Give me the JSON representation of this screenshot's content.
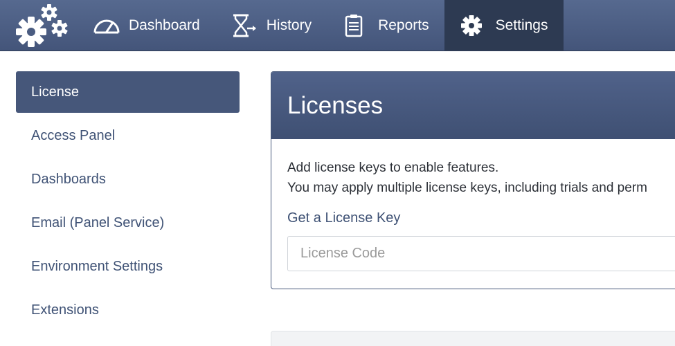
{
  "nav": {
    "logo_icon": "gears-icon",
    "items": [
      {
        "label": "Dashboard",
        "icon": "speedometer-icon"
      },
      {
        "label": "History",
        "icon": "hourglass-icon"
      },
      {
        "label": "Reports",
        "icon": "clipboard-icon"
      },
      {
        "label": "Settings",
        "icon": "gear-icon",
        "active": true
      }
    ]
  },
  "sidebar": {
    "items": [
      {
        "label": "License",
        "active": true
      },
      {
        "label": "Access Panel"
      },
      {
        "label": "Dashboards"
      },
      {
        "label": "Email (Panel Service)"
      },
      {
        "label": "Environment Settings"
      },
      {
        "label": "Extensions"
      }
    ]
  },
  "panel": {
    "title": "Licenses",
    "line1": "Add license keys to enable features.",
    "line2": "You may apply multiple license keys, including trials and perm",
    "link": "Get a License Key",
    "input_placeholder": "License Code"
  },
  "colors": {
    "navbar": "#4a5c81",
    "active_nav": "#2d3a52",
    "sidebar_active": "#46577a",
    "link": "#3f5275"
  }
}
